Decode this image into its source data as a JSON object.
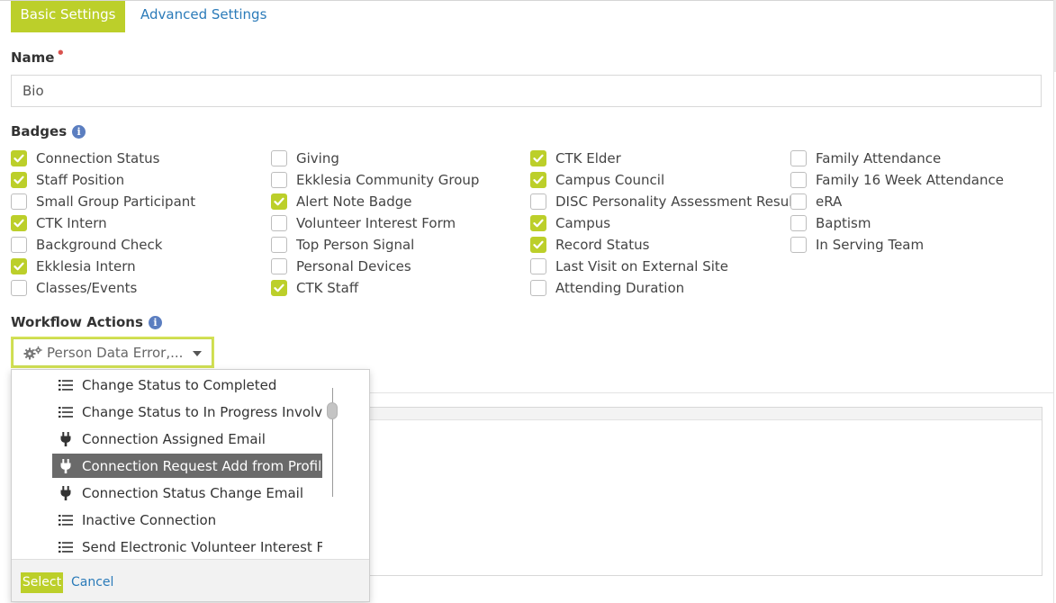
{
  "tabs": {
    "basic": "Basic Settings",
    "advanced": "Advanced Settings"
  },
  "name_field": {
    "label": "Name",
    "required_mark": "•",
    "value": "Bio"
  },
  "badges": {
    "label": "Badges",
    "columns": [
      [
        {
          "label": "Connection Status",
          "checked": true
        },
        {
          "label": "Staff Position",
          "checked": true
        },
        {
          "label": "Small Group Participant",
          "checked": false
        },
        {
          "label": "CTK Intern",
          "checked": true
        },
        {
          "label": "Background Check",
          "checked": false
        },
        {
          "label": "Ekklesia Intern",
          "checked": true
        },
        {
          "label": "Classes/Events",
          "checked": false
        }
      ],
      [
        {
          "label": "Giving",
          "checked": false
        },
        {
          "label": "Ekklesia Community Group",
          "checked": false
        },
        {
          "label": "Alert Note Badge",
          "checked": true
        },
        {
          "label": "Volunteer Interest Form",
          "checked": false
        },
        {
          "label": "Top Person Signal",
          "checked": false
        },
        {
          "label": "Personal Devices",
          "checked": false
        },
        {
          "label": "CTK Staff",
          "checked": true
        }
      ],
      [
        {
          "label": "CTK Elder",
          "checked": true
        },
        {
          "label": "Campus Council",
          "checked": true
        },
        {
          "label": "DISC Personality Assessment Result",
          "checked": false
        },
        {
          "label": "Campus",
          "checked": true
        },
        {
          "label": "Record Status",
          "checked": true
        },
        {
          "label": "Last Visit on External Site",
          "checked": false
        },
        {
          "label": "Attending Duration",
          "checked": false
        }
      ],
      [
        {
          "label": "Family Attendance",
          "checked": false
        },
        {
          "label": "Family 16 Week Attendance",
          "checked": false
        },
        {
          "label": "eRA",
          "checked": false
        },
        {
          "label": "Baptism",
          "checked": false
        },
        {
          "label": "In Serving Team",
          "checked": false
        }
      ]
    ]
  },
  "workflow": {
    "label": "Workflow Actions",
    "selected_value": "Person Data Error,...",
    "items": [
      {
        "label": "Change Status to Completed",
        "icon": "list-icon",
        "selected": false
      },
      {
        "label": "Change Status to In Progress Involveme",
        "icon": "list-icon",
        "selected": false
      },
      {
        "label": "Connection Assigned Email",
        "icon": "plug-icon",
        "selected": false
      },
      {
        "label": "Connection Request Add from Profile",
        "icon": "plug-icon",
        "selected": true
      },
      {
        "label": "Connection Status Change Email",
        "icon": "plug-icon",
        "selected": false
      },
      {
        "label": "Inactive Connection",
        "icon": "list-icon",
        "selected": false
      },
      {
        "label": "Send Electronic Volunteer Interest Form",
        "icon": "list-icon",
        "selected": false
      }
    ],
    "select_button": "Select",
    "cancel_link": "Cancel"
  },
  "colors": {
    "accent": "#bccf2a",
    "link": "#2b7bb9",
    "info": "#5b7ec0",
    "highlight": "#6a6a6a"
  }
}
